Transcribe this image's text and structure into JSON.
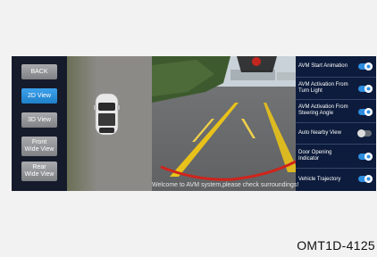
{
  "nav": {
    "back": "BACK",
    "view_2d": "2D View",
    "view_3d": "3D View",
    "front_line1": "Front",
    "front_line2": "Wide View",
    "rear_line1": "Rear",
    "rear_line2": "Wide View"
  },
  "settings": [
    {
      "label1": "AVM Start Animation",
      "label2": "",
      "on": true
    },
    {
      "label1": "AVM Activation From",
      "label2": "Turn Light",
      "on": true
    },
    {
      "label1": "AVM Activation From",
      "label2": "Steering Angle",
      "on": true
    },
    {
      "label1": "Auto Nearby View",
      "label2": "",
      "on": false
    },
    {
      "label1": "Door Opening",
      "label2": "Indicator",
      "on": true
    },
    {
      "label1": "Vehicle Trajectory",
      "label2": "",
      "on": true
    }
  ],
  "message": "Welcome to AVM system,please check surroundings!",
  "figure_code": "OMT1D-4125",
  "colors": {
    "accent": "#2f8de0",
    "panel": "#0d1c3c",
    "guide_yellow": "#e8c21a",
    "guide_red": "#d0241b"
  }
}
